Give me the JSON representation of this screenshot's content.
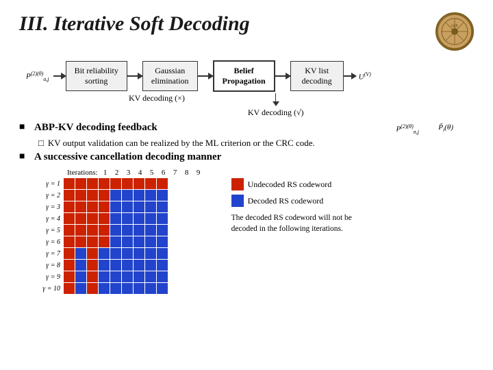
{
  "page": {
    "title": "III. Iterative Soft Decoding",
    "flowchart": {
      "formula_left": "P(2)(θ) / a,j",
      "box1": {
        "label": "Bit reliability\nsorting"
      },
      "box2": {
        "label": "Gaussian\nelimination"
      },
      "box3": {
        "label": "Belief\nPropagation",
        "highlighted": true
      },
      "box4": {
        "label": "KV list\ndecoding"
      },
      "formula_right": "U(V)",
      "kv_x": "KV decoding (×)",
      "kv_check": "KV decoding (√)"
    },
    "bullets": [
      {
        "marker": "n",
        "text": "ABP-KV decoding feedback",
        "sub": [
          {
            "marker": "q",
            "text": "KV output validation can be realized by the ML criterion or the CRC code."
          }
        ]
      },
      {
        "marker": "n",
        "text": "A successive cancellation decoding manner"
      }
    ],
    "iterations_label": "Iterations:",
    "col_headers": [
      "1",
      "2",
      "3",
      "4",
      "5",
      "6",
      "7",
      "8",
      "9"
    ],
    "rows": [
      {
        "label": "γ = 1",
        "cells": [
          "r",
          "r",
          "r",
          "r",
          "r",
          "r",
          "r",
          "r",
          "r"
        ]
      },
      {
        "label": "γ = 2",
        "cells": [
          "r",
          "r",
          "r",
          "r",
          "b",
          "b",
          "b",
          "b",
          "b"
        ]
      },
      {
        "label": "γ = 3",
        "cells": [
          "r",
          "r",
          "r",
          "r",
          "b",
          "b",
          "b",
          "b",
          "b"
        ]
      },
      {
        "label": "γ = 4",
        "cells": [
          "r",
          "r",
          "r",
          "r",
          "b",
          "b",
          "b",
          "b",
          "b"
        ]
      },
      {
        "label": "γ = 5",
        "cells": [
          "r",
          "r",
          "r",
          "r",
          "b",
          "b",
          "b",
          "b",
          "b"
        ]
      },
      {
        "label": "γ = 6",
        "cells": [
          "r",
          "r",
          "r",
          "r",
          "b",
          "b",
          "b",
          "b",
          "b"
        ]
      },
      {
        "label": "γ = 7",
        "cells": [
          "r",
          "b",
          "r",
          "b",
          "b",
          "b",
          "b",
          "b",
          "b"
        ]
      },
      {
        "label": "γ = 8",
        "cells": [
          "r",
          "b",
          "r",
          "b",
          "b",
          "b",
          "b",
          "b",
          "b"
        ]
      },
      {
        "label": "γ = 9",
        "cells": [
          "r",
          "b",
          "r",
          "b",
          "b",
          "b",
          "b",
          "b",
          "b"
        ]
      },
      {
        "label": "γ = 10",
        "cells": [
          "r",
          "b",
          "r",
          "b",
          "b",
          "b",
          "b",
          "b",
          "b"
        ]
      }
    ],
    "legend": [
      {
        "color": "#cc2200",
        "label": "Undecoded RS codeword"
      },
      {
        "color": "#2244cc",
        "label": "Decoded RS codeword"
      }
    ],
    "note": "The decoded RS codeword will not be decoded in the following iterations."
  }
}
